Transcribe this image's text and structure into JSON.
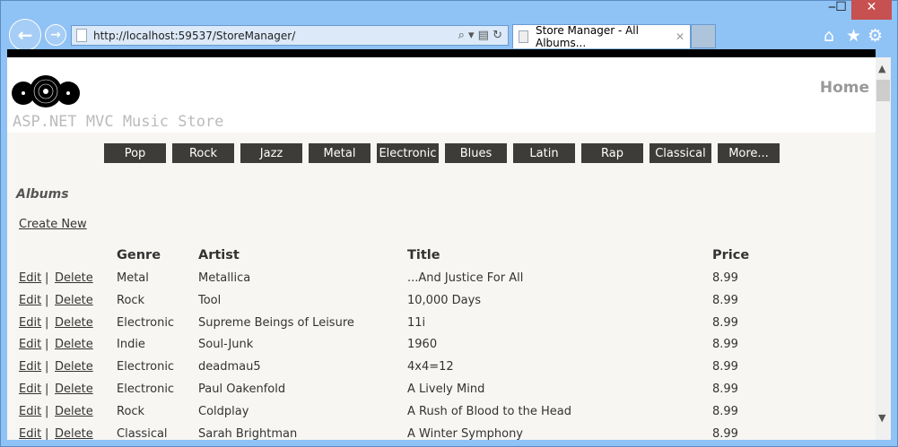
{
  "browser": {
    "url": "http://localhost:59537/StoreManager/",
    "tab_title": "Store Manager - All Albums...",
    "window_controls": {
      "minimize": "‒",
      "maximize": "☐",
      "close": "✕"
    },
    "icons": [
      "back-icon",
      "forward-icon",
      "search-icon",
      "compat-icon",
      "refresh-icon",
      "home-icon",
      "favorites-icon",
      "settings-icon"
    ]
  },
  "header": {
    "site_title": "ASP.NET MVC Music Store",
    "home_link": "Home"
  },
  "genres": [
    "Pop",
    "Rock",
    "Jazz",
    "Metal",
    "Electronic",
    "Blues",
    "Latin",
    "Rap",
    "Classical",
    "More..."
  ],
  "main": {
    "heading": "Albums",
    "create_new": "Create New",
    "edit_label": "Edit",
    "delete_label": "Delete",
    "separator": "|",
    "columns": [
      "Genre",
      "Artist",
      "Title",
      "Price"
    ],
    "rows": [
      {
        "genre": "Metal",
        "artist": "Metallica",
        "title": "...And Justice For All",
        "price": "8.99"
      },
      {
        "genre": "Rock",
        "artist": "Tool",
        "title": "10,000 Days",
        "price": "8.99"
      },
      {
        "genre": "Electronic",
        "artist": "Supreme Beings of Leisure",
        "title": "11i",
        "price": "8.99"
      },
      {
        "genre": "Indie",
        "artist": "Soul-Junk",
        "title": "1960",
        "price": "8.99"
      },
      {
        "genre": "Electronic",
        "artist": "deadmau5",
        "title": "4x4=12",
        "price": "8.99"
      },
      {
        "genre": "Electronic",
        "artist": "Paul Oakenfold",
        "title": "A Lively Mind",
        "price": "8.99"
      },
      {
        "genre": "Rock",
        "artist": "Coldplay",
        "title": "A Rush of Blood to the Head",
        "price": "8.99"
      },
      {
        "genre": "Classical",
        "artist": "Sarah Brightman",
        "title": "A Winter Symphony",
        "price": "8.99"
      }
    ]
  }
}
